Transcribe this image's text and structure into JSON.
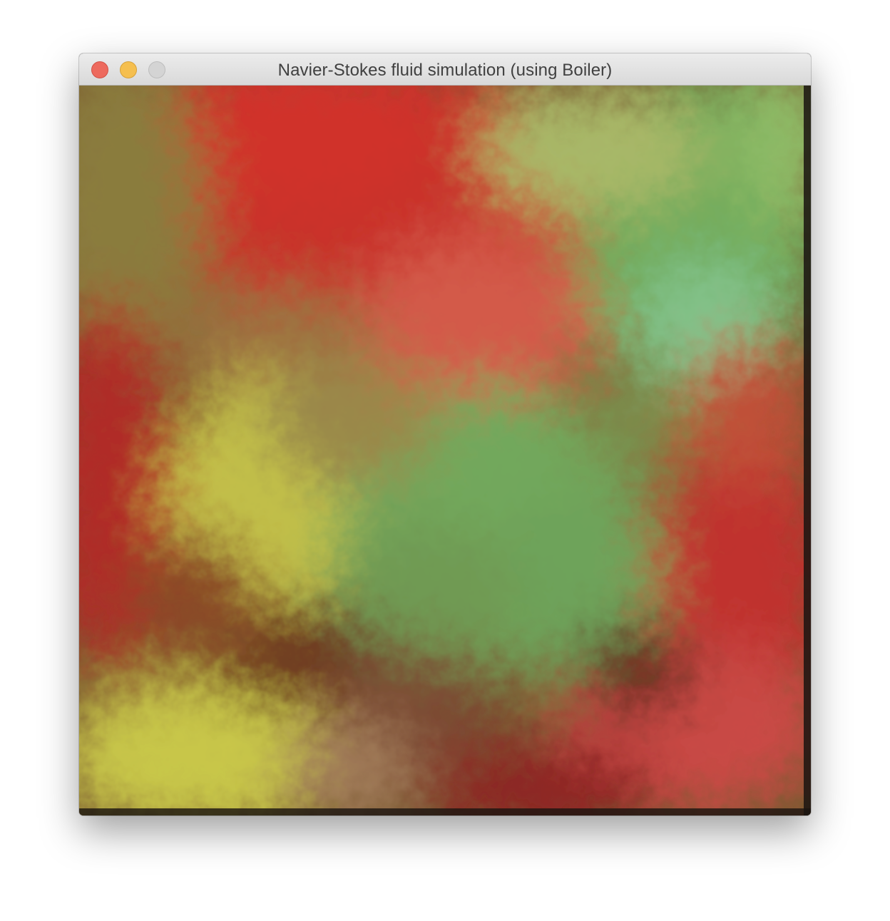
{
  "window": {
    "title": "Navier-Stokes fluid simulation (using Boiler)"
  },
  "controls": {
    "close_icon": "close-icon",
    "minimize_icon": "minimize-icon",
    "zoom_icon": "zoom-icon"
  },
  "colors": {
    "close": "#ed6a5e",
    "minimize": "#f5bf4f",
    "zoom_disabled": "#d4d4d4",
    "fluid_red": "#c8322a",
    "fluid_green": "#74b45e",
    "fluid_yellow": "#c6c44a",
    "fluid_brown": "#6b3420"
  }
}
